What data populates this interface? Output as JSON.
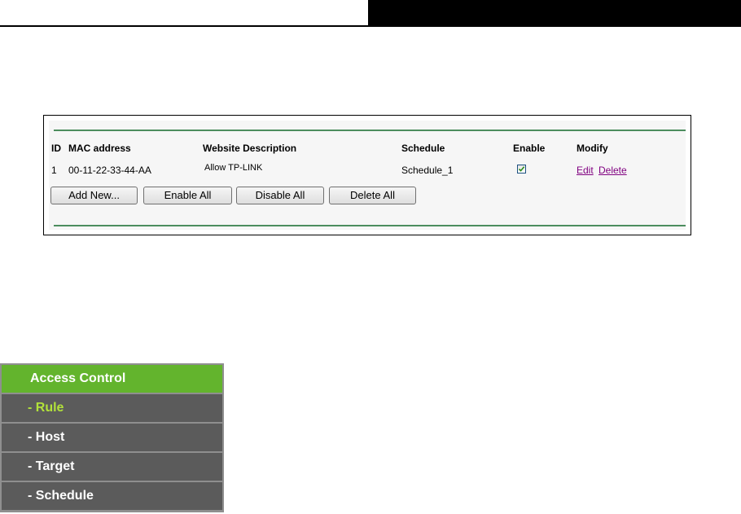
{
  "table": {
    "headers": {
      "id": "ID",
      "mac": "MAC address",
      "desc": "Website Description",
      "schedule": "Schedule",
      "enable": "Enable",
      "modify": "Modify"
    },
    "rows": [
      {
        "id": "1",
        "mac": "00-11-22-33-44-AA",
        "desc": "Allow TP-LINK",
        "schedule": "Schedule_1",
        "enabled": true,
        "edit": "Edit",
        "delete": "Delete"
      }
    ],
    "buttons": {
      "add_new": "Add New...",
      "enable_all": "Enable All",
      "disable_all": "Disable All",
      "delete_all": "Delete All"
    }
  },
  "menu": {
    "title": "Access Control",
    "items": [
      {
        "label": "- Rule",
        "active": true
      },
      {
        "label": "- Host",
        "active": false
      },
      {
        "label": "- Target",
        "active": false
      },
      {
        "label": "- Schedule",
        "active": false
      }
    ]
  },
  "colors": {
    "menu_header": "#63b42d",
    "menu_item_bg": "#5b5b5b",
    "menu_active_text": "#b2e23a",
    "panel_rule": "#4c8d5e",
    "link": "#800080"
  }
}
